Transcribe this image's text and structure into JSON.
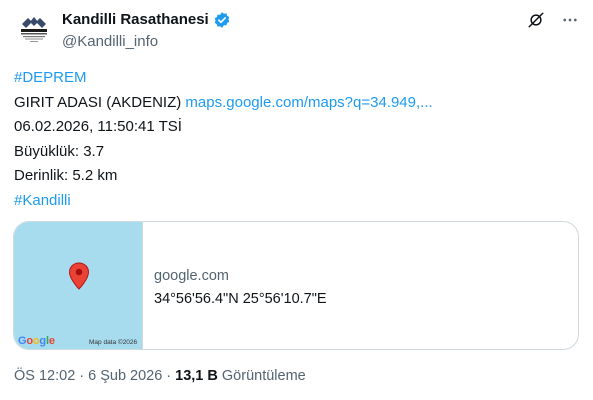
{
  "user": {
    "display_name": "Kandilli Rasathanesi",
    "handle": "@Kandilli_info",
    "verified": true
  },
  "tweet": {
    "hashtag_top": "#DEPREM",
    "location_text": "GIRIT ADASI (AKDENIZ) ",
    "map_link": "maps.google.com/maps?q=34.949,...",
    "datetime": "06.02.2026, 11:50:41 TSİ",
    "magnitude": "Büyüklük: 3.7",
    "depth": "Derinlik: 5.2 km",
    "hashtag_bottom": "#Kandilli"
  },
  "card": {
    "domain": "google.com",
    "title": "34°56'56.4\"N 25°56'10.7\"E",
    "google_logo": "Google",
    "map_data": "Map data ©2026"
  },
  "meta": {
    "time": "ÖS 12:02",
    "date": "6 Şub 2026",
    "views_count": "13,1 B",
    "views_label": "Görüntüleme"
  },
  "icons": {
    "avatar": "kandilli-logo-icon",
    "grok": "grok-icon",
    "more": "more-icon",
    "verified": "verified-badge-icon",
    "pin": "map-pin-icon"
  },
  "colors": {
    "link": "#1d9bf0",
    "verified": "#1d9bf0",
    "map_water": "#a7dcef",
    "pin": "#ea4335"
  }
}
